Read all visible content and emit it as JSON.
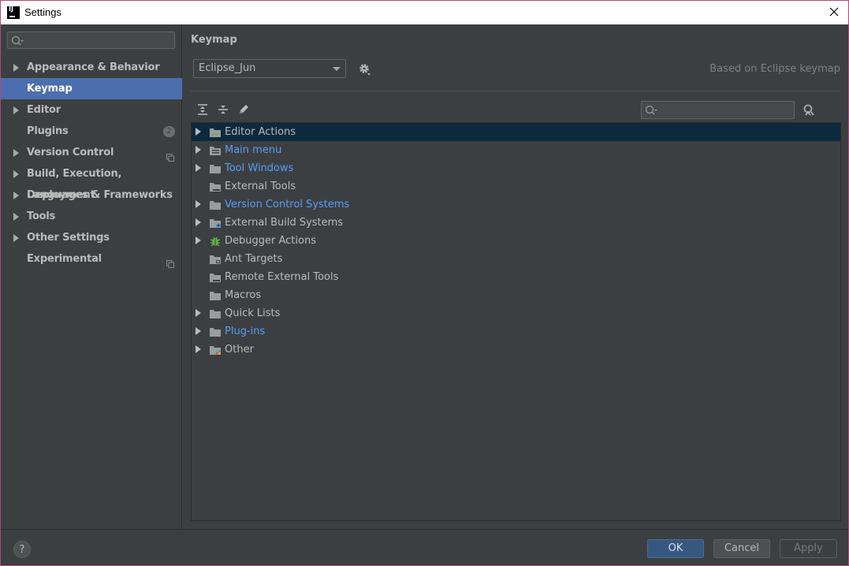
{
  "window": {
    "title": "Settings"
  },
  "sidebar": {
    "search": {
      "placeholder": ""
    },
    "items": [
      {
        "label": "Appearance & Behavior",
        "expandable": true
      },
      {
        "label": "Keymap",
        "expandable": false,
        "selected": true
      },
      {
        "label": "Editor",
        "expandable": true
      },
      {
        "label": "Plugins",
        "expandable": false,
        "badge": "2"
      },
      {
        "label": "Version Control",
        "expandable": true,
        "project_icon": "copy-icon"
      },
      {
        "label": "Build, Execution, Deployment",
        "expandable": true
      },
      {
        "label": "Languages & Frameworks",
        "expandable": true
      },
      {
        "label": "Tools",
        "expandable": true
      },
      {
        "label": "Other Settings",
        "expandable": true
      },
      {
        "label": "Experimental",
        "expandable": false,
        "project_icon": "copy-icon"
      }
    ]
  },
  "main": {
    "title": "Keymap",
    "keymap_select": {
      "value": "Eclipse_Jun"
    },
    "based_on": "Based on Eclipse keymap",
    "toolbar": {
      "expand_all": "expand-all-icon",
      "collapse_all": "collapse-all-icon",
      "edit": "pencil-icon",
      "find_by_shortcut": "find-shortcut-icon"
    },
    "tree_search": {
      "placeholder": ""
    },
    "tree": [
      {
        "label": "Editor Actions",
        "expandable": true,
        "selected": true,
        "modified": false
      },
      {
        "label": "Main menu",
        "expandable": true,
        "modified": true
      },
      {
        "label": "Tool Windows",
        "expandable": true,
        "modified": true
      },
      {
        "label": "External Tools",
        "expandable": false,
        "modified": false
      },
      {
        "label": "Version Control Systems",
        "expandable": true,
        "modified": true
      },
      {
        "label": "External Build Systems",
        "expandable": true,
        "modified": false
      },
      {
        "label": "Debugger Actions",
        "expandable": true,
        "modified": false
      },
      {
        "label": "Ant Targets",
        "expandable": false,
        "modified": false
      },
      {
        "label": "Remote External Tools",
        "expandable": false,
        "modified": false
      },
      {
        "label": "Macros",
        "expandable": false,
        "modified": false
      },
      {
        "label": "Quick Lists",
        "expandable": true,
        "modified": false
      },
      {
        "label": "Plug-ins",
        "expandable": true,
        "modified": true
      },
      {
        "label": "Other",
        "expandable": true,
        "modified": false
      }
    ]
  },
  "footer": {
    "help": "?",
    "ok": "OK",
    "cancel": "Cancel",
    "apply": "Apply"
  },
  "colors": {
    "background": "#3c3f41",
    "selection": "#4b6eaf",
    "tree_selection": "#0d293e",
    "link": "#589df6",
    "text": "#bbbbbb"
  }
}
